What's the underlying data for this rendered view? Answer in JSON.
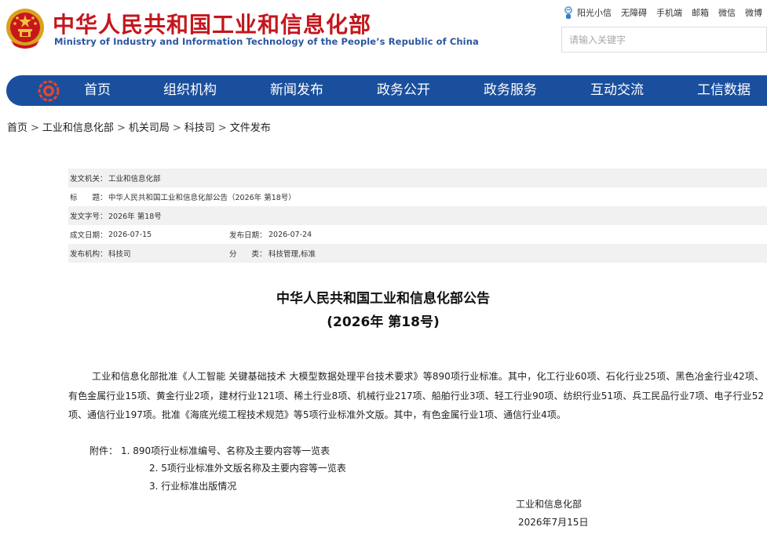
{
  "header": {
    "title": "中华人民共和国工业和信息化部",
    "subtitle": "Ministry of Industry and Information Technology of the People’s Republic of China",
    "top_links": [
      "阳光小信",
      "无障碍",
      "手机端",
      "邮箱",
      "微信",
      "微博"
    ],
    "search_placeholder": "请输入关键字"
  },
  "nav": {
    "items": [
      "首页",
      "组织机构",
      "新闻发布",
      "政务公开",
      "政务服务",
      "互动交流",
      "工信数据"
    ]
  },
  "breadcrumb": [
    "首页",
    "工业和信息化部",
    "机关司局",
    "科技司",
    "文件发布"
  ],
  "meta": {
    "issuer_label": "发文机关：",
    "issuer": "工业和信息化部",
    "title_label": "标　　题：",
    "title": "中华人民共和国工业和信息化部公告（2026年 第18号）",
    "doc_no_label": "发文字号：",
    "doc_no": "2026年 第18号",
    "written_label": "成文日期：",
    "written": "2026-07-15",
    "published_label": "发布日期：",
    "published": "2026-07-24",
    "org_label": "发布机构：",
    "org": "科技司",
    "category_label": "分　　类：",
    "category": "科技管理,标准"
  },
  "article": {
    "title_line1": "中华人民共和国工业和信息化部公告",
    "title_line2": "(2026年 第18号)",
    "body": "工业和信息化部批准《人工智能 关键基础技术 大模型数据处理平台技术要求》等890项行业标准。其中，化工行业60项、石化行业25项、黑色冶金行业42项、有色金属行业15项、黄金行业2项，建材行业121项、稀土行业8项、机械行业217项、船舶行业3项、轻工行业90项、纺织行业51项、兵工民品行业7项、电子行业52项、通信行业197项。批准《海底光缆工程技术规范》等5项行业标准外文版。其中，有色金属行业1项、通信行业4项。",
    "attachment_label": "附件：",
    "attachments": [
      "1. 890项行业标准编号、名称及主要内容等一览表",
      "2. 5项行业标准外文版名称及主要内容等一览表",
      "3. 行业标准出版情况"
    ],
    "signature_org": "工业和信息化部",
    "signature_date": "2026年7月15日"
  },
  "colors": {
    "brand_red": "#c4161c",
    "brand_blue": "#1a4f9e",
    "subtitle_blue": "#2a56a0"
  }
}
